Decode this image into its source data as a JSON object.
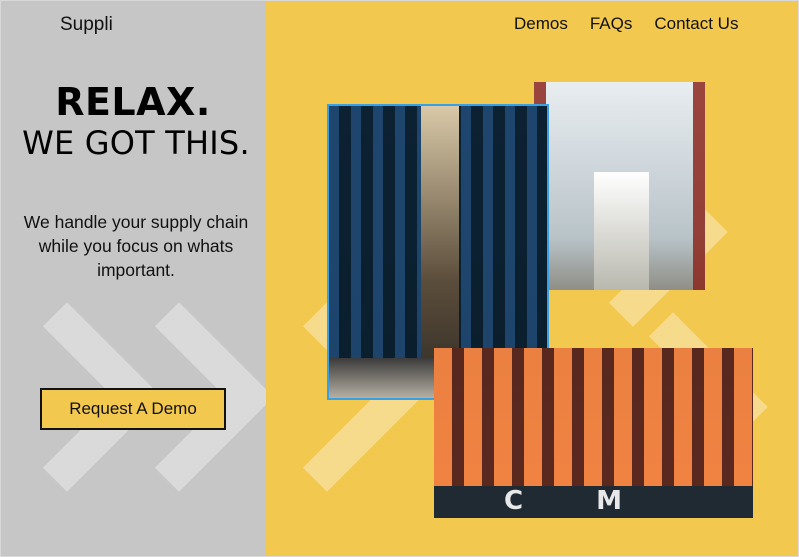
{
  "brand": "Suppli",
  "nav": [
    "Demos",
    "FAQs",
    "Contact Us"
  ],
  "hero": {
    "headline": "RELAX.",
    "subheadline": "WE GOT THIS.",
    "tagline": "We handle your supply chain while you focus on whats important.",
    "cta": "Request A Demo"
  },
  "images": [
    {
      "name": "warehouse-automated-aisle-image"
    },
    {
      "name": "warehouse-person-aisle-image"
    },
    {
      "name": "container-ship-port-image",
      "hull_text": "C M"
    }
  ],
  "colors": {
    "left_panel": "#c6c6c6",
    "accent_yellow": "#f3c84f",
    "text": "#111111",
    "selection_blue": "#3aa0e6"
  }
}
